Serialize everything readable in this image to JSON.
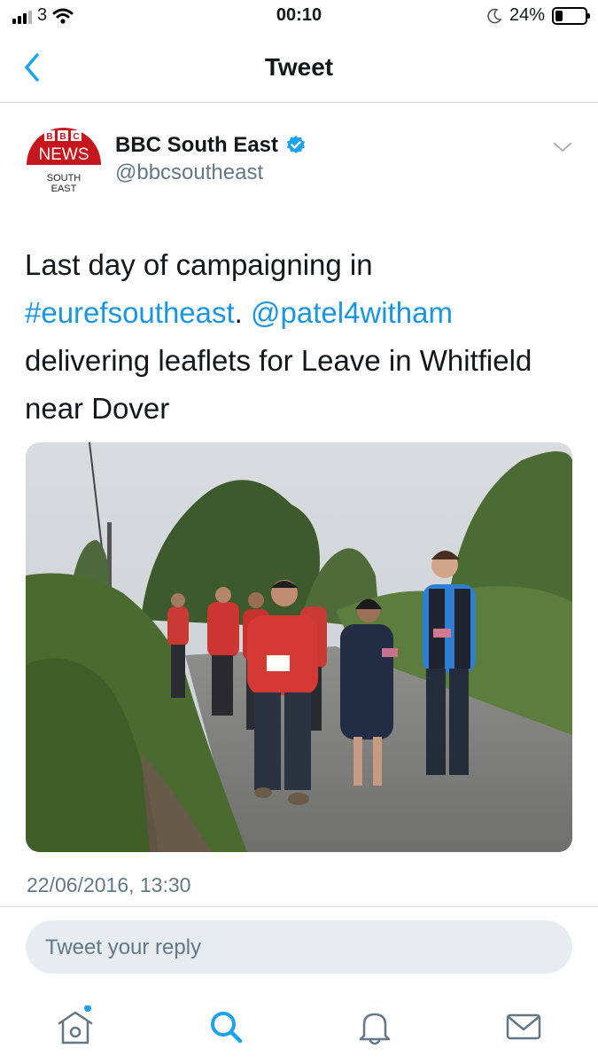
{
  "status_bar": {
    "carrier": "3",
    "time": "00:10",
    "battery_percent": "24%",
    "battery_level": 0.24,
    "icons": [
      "signal-icon",
      "wifi-icon",
      "moon-icon",
      "battery-icon"
    ]
  },
  "nav": {
    "title": "Tweet",
    "back_icon": "chevron-left-icon"
  },
  "tweet": {
    "author_name": "BBC South East",
    "handle": "@bbcsoutheast",
    "verified": true,
    "avatar_logo": {
      "line1": "BBC",
      "line2": "NEWS",
      "line3": "SOUTH",
      "line4": "EAST"
    },
    "text_parts": {
      "p1": "Last day of campaigning in ",
      "hashtag": "#eurefsoutheast",
      "p2": ". ",
      "mention": "@patel4witham",
      "p3": " delivering leaflets for Leave in Whitfield near Dover"
    },
    "timestamp": "22/06/2016, 13:30"
  },
  "reply": {
    "placeholder": "Tweet your reply"
  },
  "tabs": [
    {
      "icon": "home-icon",
      "has_notification_dot": true
    },
    {
      "icon": "search-icon",
      "active": true
    },
    {
      "icon": "bell-icon"
    },
    {
      "icon": "mail-icon"
    }
  ],
  "colors": {
    "accent": "#1da1f2",
    "link": "#1b95e0",
    "secondary_text": "#657786",
    "bbc_red": "#c4161c"
  }
}
